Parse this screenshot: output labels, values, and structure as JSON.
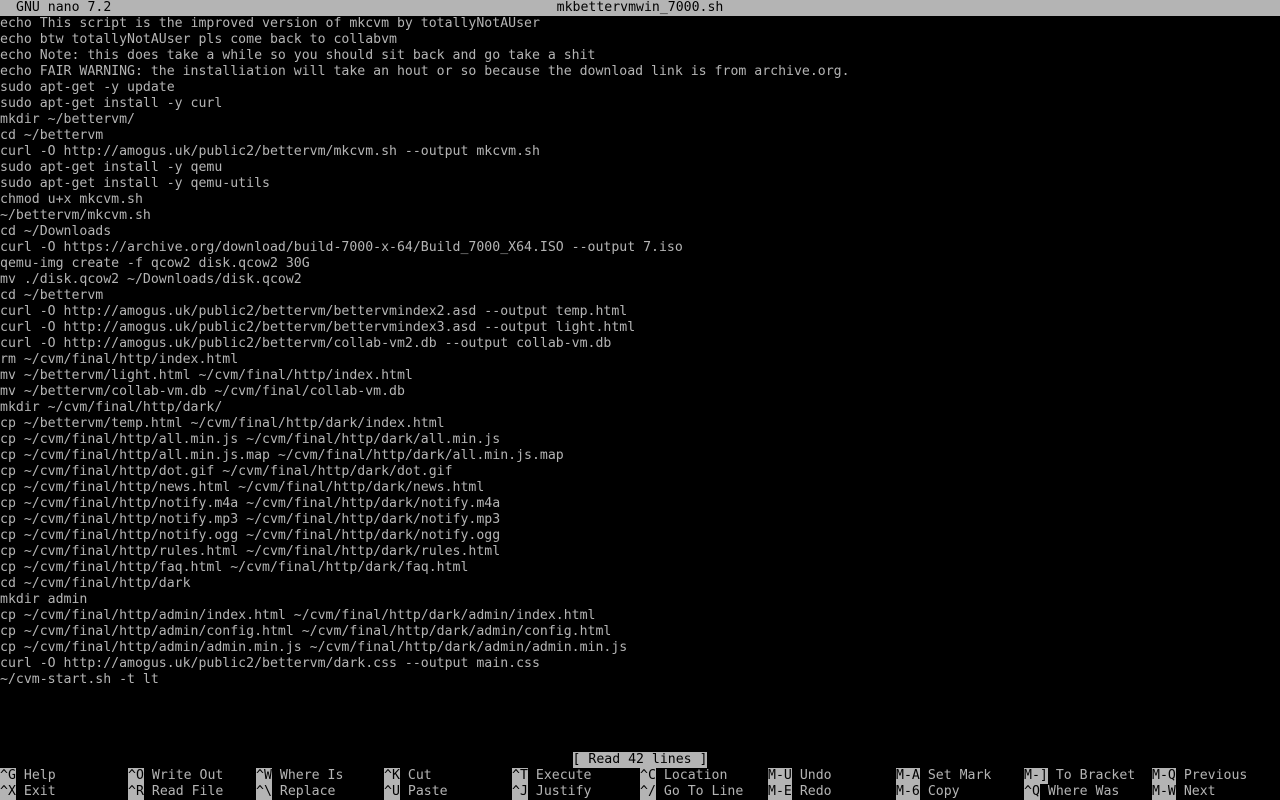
{
  "titlebar": {
    "app_name": "GNU nano 7.2",
    "file_name": "mkbettervmwin_7000.sh"
  },
  "lines": [
    "echo This script is the improved version of mkcvm by totallyNotAUser",
    "echo btw totallyNotAUser pls come back to collabvm",
    "echo Note: this does take a while so you should sit back and go take a shit",
    "echo FAIR WARNING: the installiation will take an hout or so because the download link is from archive.org.",
    "sudo apt-get -y update",
    "sudo apt-get install -y curl",
    "mkdir ~/bettervm/",
    "cd ~/bettervm",
    "curl -O http://amogus.uk/public2/bettervm/mkcvm.sh --output mkcvm.sh",
    "sudo apt-get install -y qemu",
    "sudo apt-get install -y qemu-utils",
    "chmod u+x mkcvm.sh",
    "~/bettervm/mkcvm.sh",
    "cd ~/Downloads",
    "curl -O https://archive.org/download/build-7000-x-64/Build_7000_X64.ISO --output 7.iso",
    "qemu-img create -f qcow2 disk.qcow2 30G",
    "mv ./disk.qcow2 ~/Downloads/disk.qcow2",
    "cd ~/bettervm",
    "curl -O http://amogus.uk/public2/bettervm/bettervmindex2.asd --output temp.html",
    "curl -O http://amogus.uk/public2/bettervm/bettervmindex3.asd --output light.html",
    "curl -O http://amogus.uk/public2/bettervm/collab-vm2.db --output collab-vm.db",
    "rm ~/cvm/final/http/index.html",
    "mv ~/bettervm/light.html ~/cvm/final/http/index.html",
    "mv ~/bettervm/collab-vm.db ~/cvm/final/collab-vm.db",
    "mkdir ~/cvm/final/http/dark/",
    "cp ~/bettervm/temp.html ~/cvm/final/http/dark/index.html",
    "cp ~/cvm/final/http/all.min.js ~/cvm/final/http/dark/all.min.js",
    "cp ~/cvm/final/http/all.min.js.map ~/cvm/final/http/dark/all.min.js.map",
    "cp ~/cvm/final/http/dot.gif ~/cvm/final/http/dark/dot.gif",
    "cp ~/cvm/final/http/news.html ~/cvm/final/http/dark/news.html",
    "cp ~/cvm/final/http/notify.m4a ~/cvm/final/http/dark/notify.m4a",
    "cp ~/cvm/final/http/notify.mp3 ~/cvm/final/http/dark/notify.mp3",
    "cp ~/cvm/final/http/notify.ogg ~/cvm/final/http/dark/notify.ogg",
    "cp ~/cvm/final/http/rules.html ~/cvm/final/http/dark/rules.html",
    "cp ~/cvm/final/http/faq.html ~/cvm/final/http/dark/faq.html",
    "cd ~/cvm/final/http/dark",
    "mkdir admin",
    "cp ~/cvm/final/http/admin/index.html ~/cvm/final/http/dark/admin/index.html",
    "cp ~/cvm/final/http/admin/config.html ~/cvm/final/http/dark/admin/config.html",
    "cp ~/cvm/final/http/admin/admin.min.js ~/cvm/final/http/dark/admin/admin.min.js",
    "curl -O http://amogus.uk/public2/bettervm/dark.css --output main.css",
    "~/cvm-start.sh -t lt"
  ],
  "status": "[ Read 42 lines ]",
  "shortcuts": {
    "row1": [
      {
        "key": "^G",
        "label": "Help"
      },
      {
        "key": "^O",
        "label": "Write Out"
      },
      {
        "key": "^W",
        "label": "Where Is"
      },
      {
        "key": "^K",
        "label": "Cut"
      },
      {
        "key": "^T",
        "label": "Execute"
      },
      {
        "key": "^C",
        "label": "Location"
      },
      {
        "key": "M-U",
        "label": "Undo"
      },
      {
        "key": "M-A",
        "label": "Set Mark"
      },
      {
        "key": "M-]",
        "label": "To Bracket"
      },
      {
        "key": "M-Q",
        "label": "Previous"
      }
    ],
    "row2": [
      {
        "key": "^X",
        "label": "Exit"
      },
      {
        "key": "^R",
        "label": "Read File"
      },
      {
        "key": "^\\",
        "label": "Replace"
      },
      {
        "key": "^U",
        "label": "Paste"
      },
      {
        "key": "^J",
        "label": "Justify"
      },
      {
        "key": "^/",
        "label": "Go To Line"
      },
      {
        "key": "M-E",
        "label": "Redo"
      },
      {
        "key": "M-6",
        "label": "Copy"
      },
      {
        "key": "^Q",
        "label": "Where Was"
      },
      {
        "key": "M-W",
        "label": "Next"
      }
    ]
  },
  "colors": {
    "background": "#000000",
    "foreground": "#b4b4b4",
    "inverse_bg": "#b4b4b4",
    "inverse_fg": "#000000"
  }
}
